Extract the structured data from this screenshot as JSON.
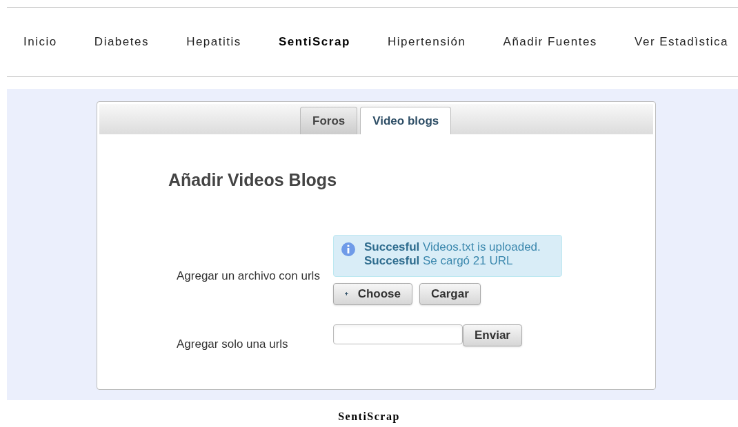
{
  "nav": [
    {
      "label": "Inicio",
      "selected": false
    },
    {
      "label": "Diabetes",
      "selected": false
    },
    {
      "label": "Hepatitis",
      "selected": false
    },
    {
      "label": "SentiScrap",
      "selected": true
    },
    {
      "label": "Hipertensión",
      "selected": false
    },
    {
      "label": "Añadir Fuentes",
      "selected": false
    },
    {
      "label": "Ver Estadìstica",
      "selected": false
    }
  ],
  "tabs": [
    {
      "label": "Foros",
      "selected": false
    },
    {
      "label": "Video blogs",
      "selected": true
    }
  ],
  "heading": "Añadir Videos Blogs",
  "file_form": {
    "label": "Agregar un archivo con urls",
    "messages": [
      "**Succesful** Videos.txt is uploaded.",
      "**Succesful** Se cargó 21 URL"
    ],
    "choose_button": "Choose",
    "upload_button": "Cargar"
  },
  "url_form": {
    "label": "Agregar solo una urls",
    "send_button": "Enviar"
  },
  "footer": "SentiScrap"
}
